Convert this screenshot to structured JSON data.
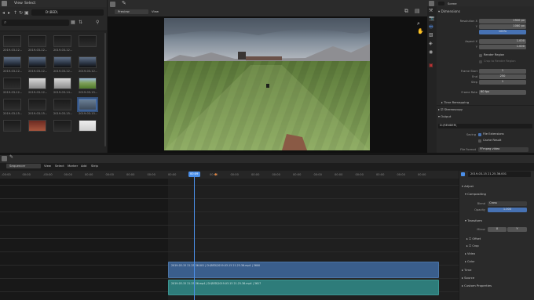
{
  "file_browser": {
    "menu": [
      "View",
      "Select"
    ],
    "path": "D:\\BED\\",
    "thumbnails": [
      {
        "label": "2019-03-12...",
        "style": "dark"
      },
      {
        "label": "2019-03-12...",
        "style": "dark"
      },
      {
        "label": "2019-03-12...",
        "style": "dark"
      },
      {
        "label": "",
        "style": "dark"
      },
      {
        "label": "2019-03-12...",
        "style": "photo"
      },
      {
        "label": "2019-03-12...",
        "style": "photo"
      },
      {
        "label": "2019-03-12...",
        "style": "photo"
      },
      {
        "label": "2019-03-12...",
        "style": "photo"
      },
      {
        "label": "2019-03-12...",
        "style": "dark"
      },
      {
        "label": "2019-03-12...",
        "style": "doc"
      },
      {
        "label": "2019-03-14...",
        "style": "doc"
      },
      {
        "label": "2019-03-15...",
        "style": "green"
      },
      {
        "label": "2019-03-15...",
        "style": "dark"
      },
      {
        "label": "2019-03-15...",
        "style": "dark"
      },
      {
        "label": "2019-03-15...",
        "style": "dark"
      },
      {
        "label": "2019-03-15...",
        "style": "selected"
      },
      {
        "label": "",
        "style": "dark"
      },
      {
        "label": "",
        "style": "red"
      },
      {
        "label": "",
        "style": "dark"
      },
      {
        "label": "",
        "style": "white"
      }
    ]
  },
  "preview": {
    "mode": "Preview",
    "view_menu": "View"
  },
  "properties": {
    "scene_label": "Scene",
    "dimensions_title": "Dimensions",
    "resolution_x_label": "Resolution X",
    "resolution_x": "1920 px",
    "y_label": "Y",
    "resolution_y": "1080 px",
    "percent": "100%",
    "aspect_x_label": "Aspect X",
    "aspect_x": "1.000",
    "aspect_y": "1.000",
    "render_region": "Render Region",
    "crop_region": "Crop to Render Region",
    "frame_start_label": "Frame Start",
    "frame_start": "1",
    "end_label": "End",
    "frame_end": "250",
    "step_label": "Step",
    "frame_step": "1",
    "frame_rate_label": "Frame Rate",
    "frame_rate": "60 fps",
    "time_remapping": "Time Remapping",
    "stereoscopy": "Stereoscopy",
    "output": "Output",
    "output_path": "D:\\RENDER\\",
    "saving_label": "Saving",
    "file_extensions": "File Extensions",
    "cache_result": "Cache Result",
    "file_format_label": "File Format",
    "file_format": "FFmpeg video"
  },
  "sequencer": {
    "view_type": "Sequencer",
    "menu": [
      "View",
      "Select",
      "Marker",
      "Add",
      "Strip"
    ],
    "current_frame": "00:09",
    "ticks": [
      "-00:00",
      "00:00",
      "-00:00",
      "00:00",
      "00:00",
      "00:00",
      "00:00",
      "00:00",
      "00:00",
      "00:00",
      "00:00",
      "00:00",
      "00:00",
      "00:00",
      "00:00",
      "00:00",
      "00:00",
      "00:00",
      "00:00",
      "00:00",
      "00:00"
    ],
    "strip_name_field": "2019-03-15 21.25.36.001",
    "strip_top_label": "2019-03-15 21.25.36.001 | D:\\BED\\2019-03-15 21.25.36.mp4 | 3600",
    "strip_bottom_label": "2019-03-15 21.25.36.mp4 | D:\\BED\\2019-03-15 21.25.36.mp4 | 3617",
    "strip_top_color": "#3a5e8c",
    "strip_bottom_color": "#2e7c7a"
  },
  "strip_sidebar": {
    "adjust": "Adjust",
    "compositing": "Compositing",
    "blend_label": "Blend",
    "blend_value": "Cross",
    "opacity_label": "Opacity",
    "opacity_value": "1.000",
    "transform": "Transform",
    "mirror_label": "Mirror",
    "mirror_x": "X",
    "mirror_y": "Y",
    "offset": "Offset",
    "crop": "Crop",
    "video": "Video",
    "color": "Color",
    "time": "Time",
    "source": "Source",
    "custom_properties": "Custom Properties"
  },
  "colors": {
    "accent": "#4772b3",
    "playhead": "#4b8fe8",
    "marker": "#e0803a"
  }
}
